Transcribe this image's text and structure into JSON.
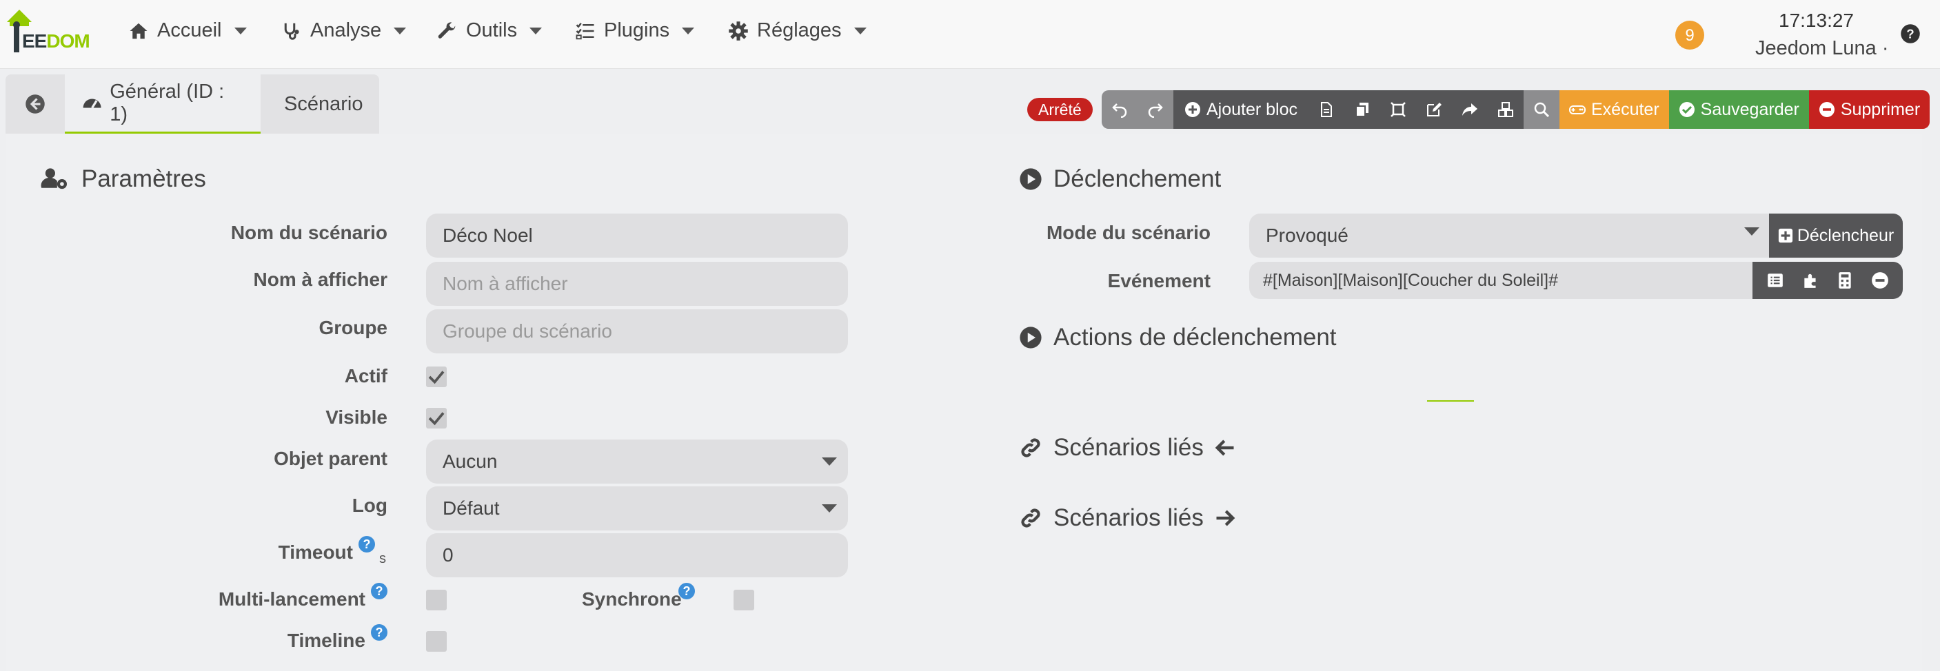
{
  "nav": {
    "logo_text_a": "EE",
    "logo_text_b": "DOM",
    "items": [
      {
        "label": "Accueil",
        "icon": "home-icon"
      },
      {
        "label": "Analyse",
        "icon": "stethoscope-icon"
      },
      {
        "label": "Outils",
        "icon": "wrench-icon"
      },
      {
        "label": "Plugins",
        "icon": "tasks-icon"
      },
      {
        "label": "Réglages",
        "icon": "gear-icon"
      }
    ],
    "notifications": "9",
    "clock": "17:13:27",
    "user": "Jeedom Luna",
    "user_suffix": "·"
  },
  "tabs": {
    "general": "Général (ID : 1)",
    "scenario": "Scénario"
  },
  "toolbar": {
    "status": "Arrêté",
    "add_block": "Ajouter bloc",
    "execute": "Exécuter",
    "save": "Sauvegarder",
    "delete": "Supprimer"
  },
  "params": {
    "title": "Paramètres",
    "name_label": "Nom du scénario",
    "name_value": "Déco Noel",
    "display_label": "Nom à afficher",
    "display_placeholder": "Nom à afficher",
    "group_label": "Groupe",
    "group_placeholder": "Groupe du scénario",
    "active_label": "Actif",
    "active_checked": true,
    "visible_label": "Visible",
    "visible_checked": true,
    "parent_label": "Objet parent",
    "parent_value": "Aucun",
    "log_label": "Log",
    "log_value": "Défaut",
    "timeout_label": "Timeout",
    "timeout_unit": "s",
    "timeout_value": "0",
    "multi_label": "Multi-lancement",
    "multi_checked": false,
    "sync_label": "Synchrone",
    "sync_checked": false,
    "timeline_label": "Timeline",
    "timeline_checked": false
  },
  "trigger": {
    "title": "Déclenchement",
    "mode_label": "Mode du scénario",
    "mode_value": "Provoqué",
    "trigger_button": "Déclencheur",
    "event_label": "Evénement",
    "event_value": "#[Maison][Maison][Coucher du Soleil]#",
    "actions_title": "Actions de déclenchement",
    "linked_in_title": "Scénarios liés",
    "linked_out_title": "Scénarios liés"
  },
  "colors": {
    "accent": "#94ca02",
    "danger": "#c5221f",
    "warning": "#f0a030",
    "success": "#4ea049",
    "dark_button": "#555557"
  }
}
